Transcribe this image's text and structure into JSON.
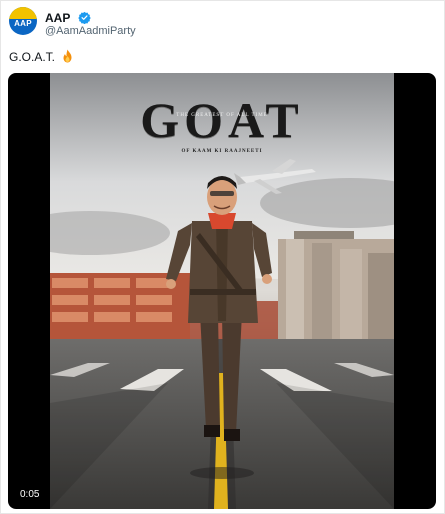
{
  "author": {
    "display_name": "AAP",
    "handle": "@AamAadmiParty",
    "avatar_text": "AAP",
    "verified_icon": "verified-badge-icon",
    "verified_color": "#1d9bf0"
  },
  "tweet": {
    "text": "G.O.A.T.",
    "emoji_icon": "fire-icon"
  },
  "media": {
    "poster": {
      "title": "GOAT",
      "banner": "THE GREATEST OF ALL TIME",
      "subtitle": "OF KAAM KI RAAJNEETI"
    },
    "duration": "0:05"
  }
}
